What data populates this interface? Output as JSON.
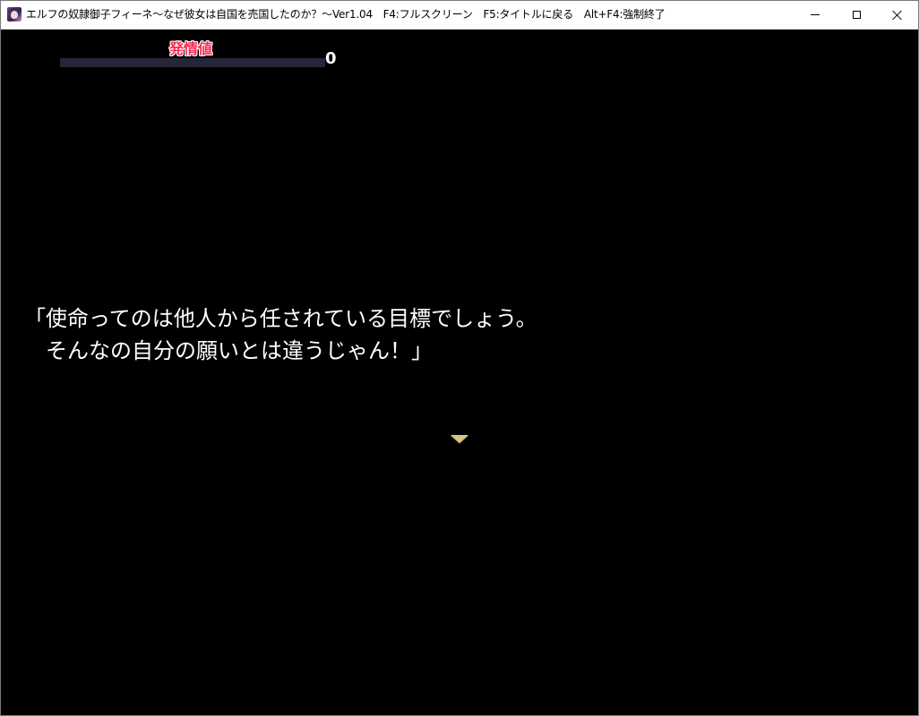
{
  "window": {
    "title": "エルフの奴隷御子フィーネ～なぜ彼女は自国を売国したのか？～Ver1.04　F4:フルスクリーン　F5:タイトルに戻る　Alt+F4:強制終了",
    "icon": "app-character-icon",
    "controls": {
      "minimize_icon": "minimize-icon",
      "maximize_icon": "maximize-icon",
      "close_icon": "close-icon"
    }
  },
  "hud": {
    "gauge_label": "発情値",
    "gauge_value": "0",
    "gauge_level": 0,
    "label_color": "#ff2a55",
    "track_color": "#26263a"
  },
  "dialogue": {
    "line1": "「使命ってのは他人から任されている目標でしょう。",
    "line2": "　そんなの自分の願いとは違うじゃん！」",
    "advance_icon": "triangle-down-icon"
  }
}
